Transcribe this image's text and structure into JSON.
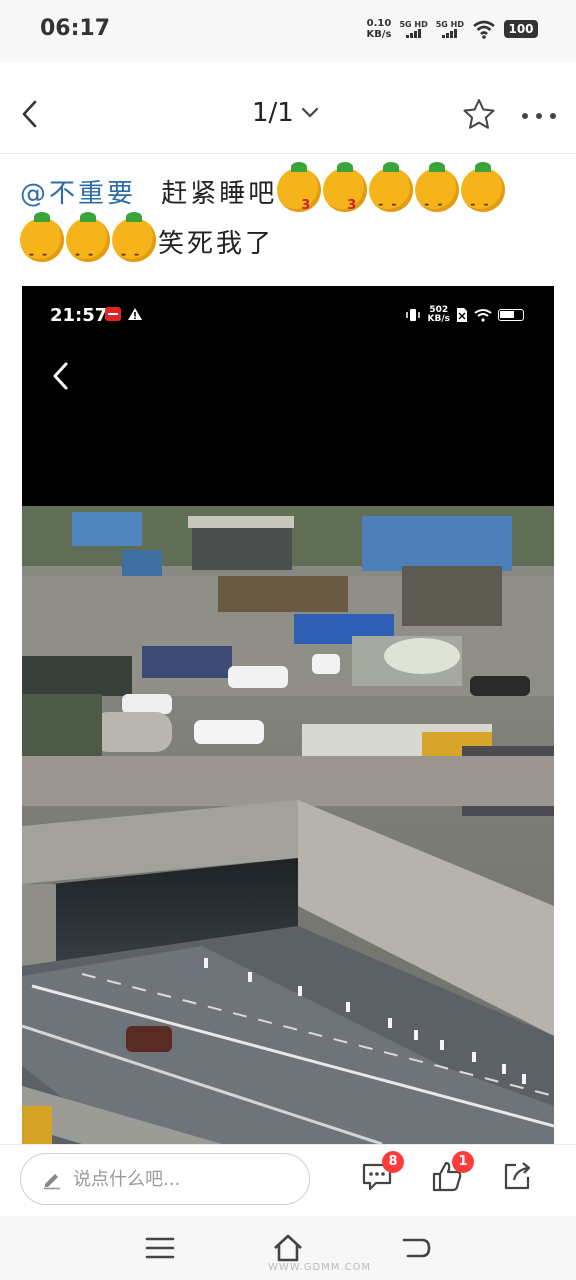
{
  "status_bar": {
    "time": "06:17",
    "net_speed_value": "0.10",
    "net_speed_unit": "KB/s",
    "sim1": "5G HD",
    "sim2": "5G HD",
    "battery": "100"
  },
  "header": {
    "page_indicator": "1/1",
    "icons": [
      "back-arrow-icon",
      "chevron-down-icon",
      "star-icon",
      "more-icon"
    ]
  },
  "post": {
    "mention": "@不重要",
    "text1": "赶紧睡吧",
    "text2": "笑死我了",
    "emojis_row1": [
      "kiss",
      "kiss",
      "laugh",
      "laugh",
      "laugh"
    ],
    "emojis_row2": [
      "laugh",
      "laugh",
      "laugh"
    ]
  },
  "screenshot": {
    "status_time": "21:57",
    "net_speed_value": "502",
    "net_speed_unit": "KB/s"
  },
  "bottom_bar": {
    "comment_placeholder": "说点什么吧...",
    "comment_badge": "8",
    "like_badge": "1"
  },
  "nav_bar": {
    "watermark": "WWW.GDMM.COM"
  },
  "colors": {
    "mention": "#2e6ca6",
    "badge": "#ff3b3b"
  }
}
